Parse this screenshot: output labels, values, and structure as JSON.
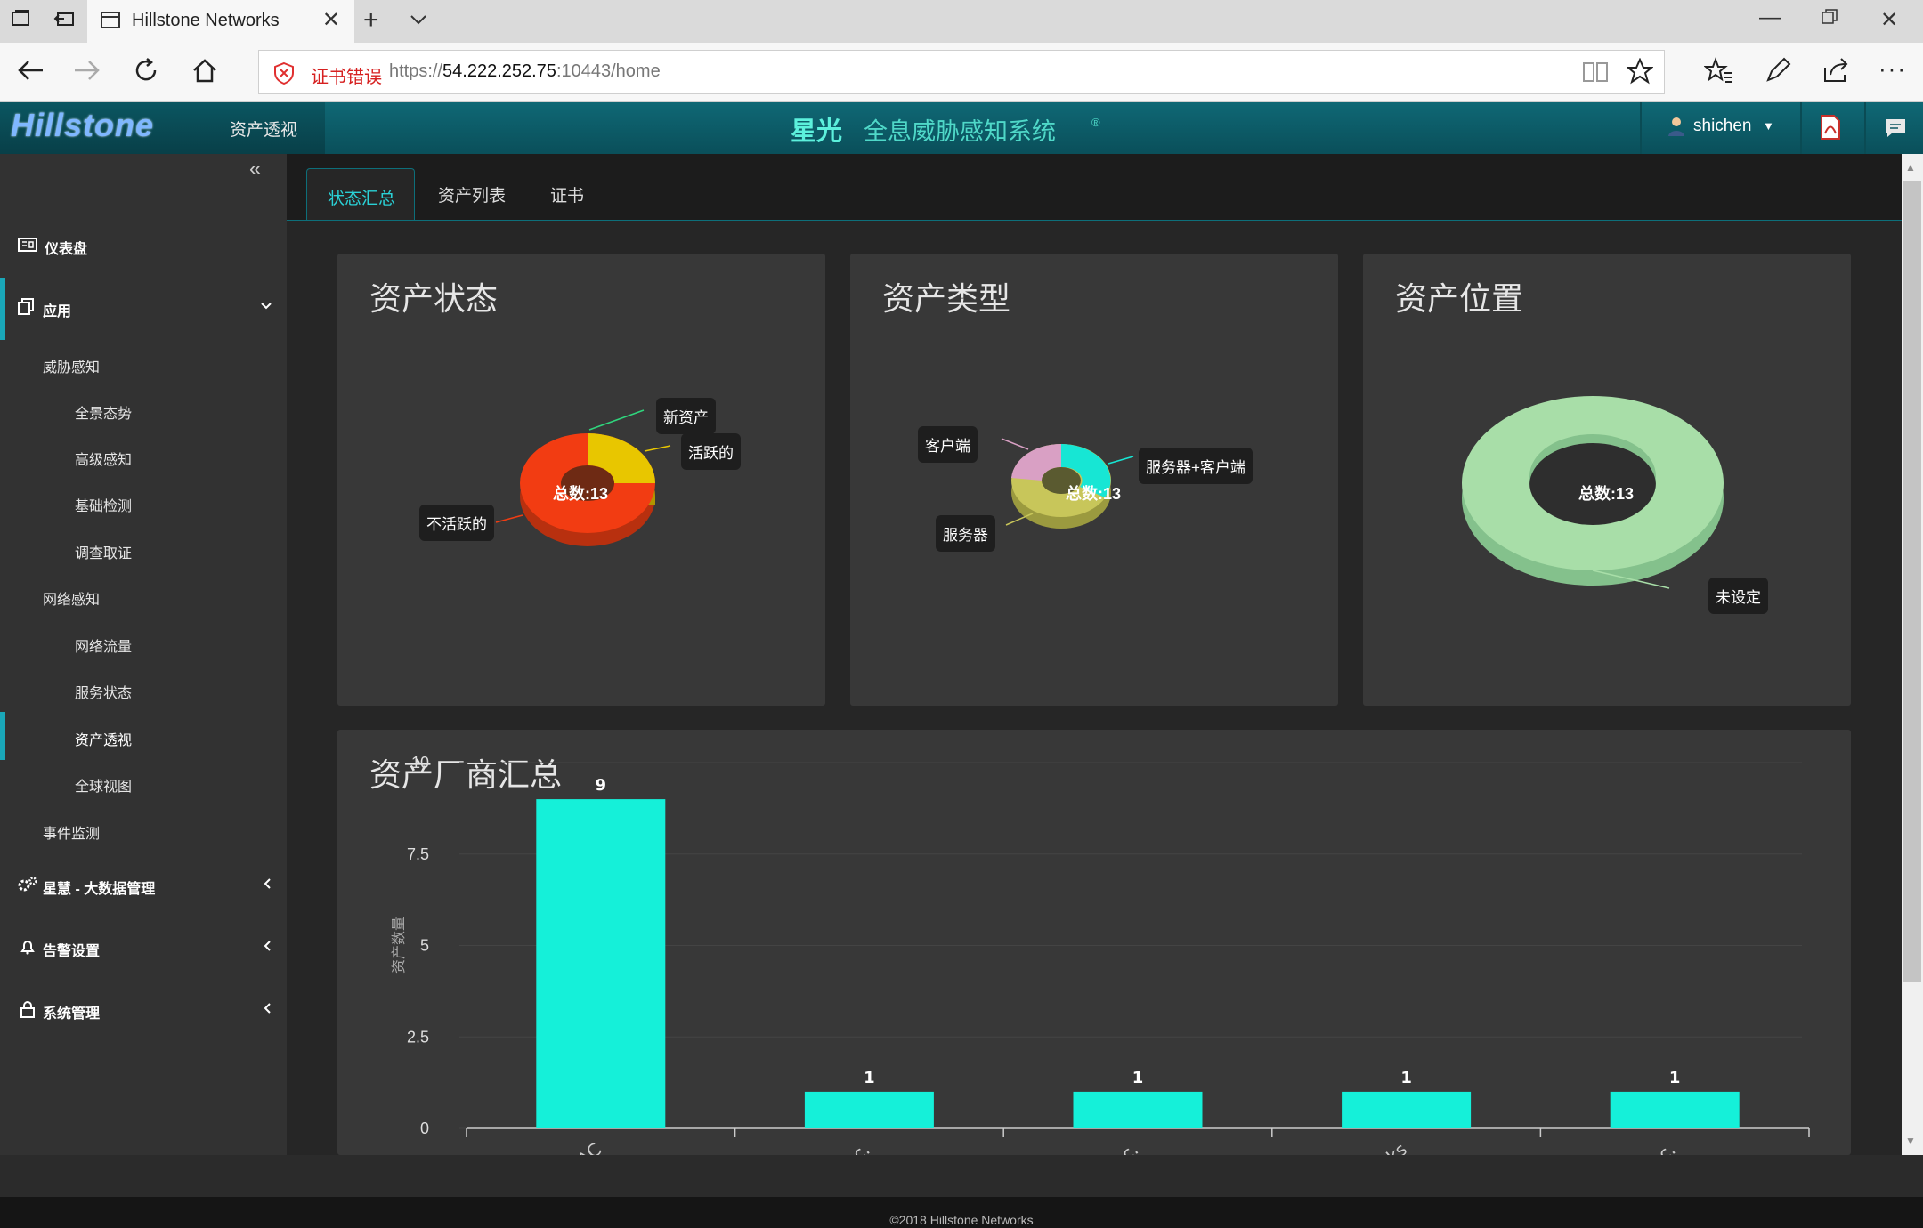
{
  "browser": {
    "tab_title": "Hillstone Networks",
    "cert_error": "证书错误",
    "url_prefix": "https://",
    "url_host": "54.222.252.75",
    "url_rest": ":10443/home"
  },
  "app": {
    "logo_text": "Hillstone",
    "module": "资产透视",
    "product_brand": "星光",
    "product_name": "全息威胁感知系统",
    "registered": "®",
    "user": "shichen",
    "colors": {
      "accent": "#1aa7b8",
      "header": "#0c5c67",
      "bar": "#15f0d9"
    }
  },
  "sidebar": {
    "collapse_icon": "«",
    "dashboard": "仪表盘",
    "apps": "应用",
    "threat_perception": "威胁感知",
    "threat_items": [
      "全景态势",
      "高级感知",
      "基础检测",
      "调查取证"
    ],
    "network_perception": "网络感知",
    "network_items": [
      "网络流量",
      "服务状态",
      "资产透视",
      "全球视图"
    ],
    "event_monitor": "事件监测",
    "bigdata": "星慧 - 大数据管理",
    "alerts": "告警设置",
    "system": "系统管理"
  },
  "tabs": [
    "状态汇总",
    "资产列表",
    "证书"
  ],
  "cards": {
    "status": {
      "title": "资产状态",
      "total": "总数:13",
      "labels": {
        "new": "新资产",
        "active": "活跃的",
        "inactive": "不活跃的"
      }
    },
    "type": {
      "title": "资产类型",
      "total": "总数:13",
      "labels": {
        "client": "客户端",
        "server_client": "服务器+客户端",
        "server": "服务器"
      }
    },
    "location": {
      "title": "资产位置",
      "total": "总数:13",
      "labels": {
        "unset": "未设定"
      }
    },
    "vendor": {
      "title": "资产厂商汇总"
    }
  },
  "chart_data": {
    "type": "bar",
    "title": "资产厂商汇总",
    "ylabel": "资产数量",
    "xlabel": "",
    "ylim": [
      0,
      10
    ],
    "yticks": [
      "0",
      "2.5",
      "5",
      "7.5",
      "10"
    ],
    "categories": [
      "ned MAC",
      "are, Inc.",
      "ter, Inc.",
      "Networks",
      "ple, Inc."
    ],
    "values": [
      9,
      1,
      1,
      1,
      1
    ],
    "grid": true
  },
  "footer": "©2018 Hillstone Networks"
}
